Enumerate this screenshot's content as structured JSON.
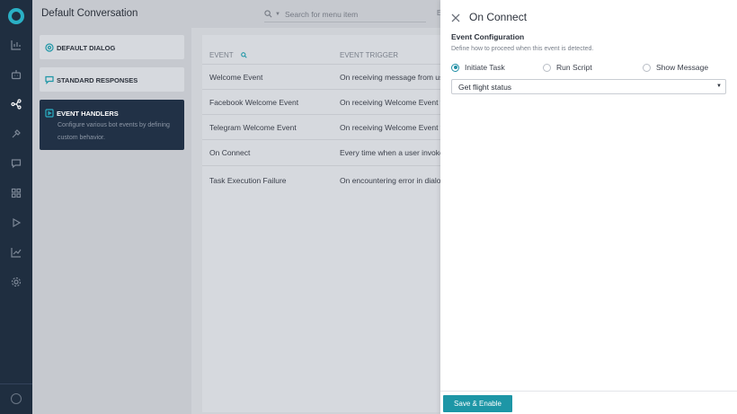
{
  "header": {
    "title": "Default Conversation",
    "search_placeholder": "Search for menu item",
    "cut_text": "E"
  },
  "sidebar_rail": {
    "items": [
      "dashboard-icon",
      "bot-icon",
      "flow-icon",
      "tools-icon",
      "chat-icon",
      "apps-icon",
      "play-icon",
      "analytics-icon",
      "settings-icon"
    ],
    "active_index": 2
  },
  "side_panel": {
    "cards": [
      {
        "label": "DEFAULT DIALOG"
      },
      {
        "label": "STANDARD RESPONSES"
      },
      {
        "label": "EVENT HANDLERS",
        "description": "Configure various bot events by defining custom behavior."
      }
    ]
  },
  "table": {
    "headers": {
      "event": "EVENT",
      "trigger": "EVENT TRIGGER"
    },
    "rows": [
      {
        "event": "Welcome Event",
        "trigger": "On receiving message from use"
      },
      {
        "event": "Facebook Welcome Event",
        "trigger": "On receiving Welcome Event f"
      },
      {
        "event": "Telegram Welcome Event",
        "trigger": "On receiving Welcome Event f"
      },
      {
        "event": "On Connect",
        "trigger": "Every time when a user invoke"
      },
      {
        "event": "Task Execution Failure",
        "trigger": "On encountering error in dialo"
      }
    ]
  },
  "panel": {
    "title": "On Connect",
    "section": "Event Configuration",
    "hint": "Define how to proceed when this event is detected.",
    "options": [
      {
        "label": "Initiate Task",
        "selected": true
      },
      {
        "label": "Run Script",
        "selected": false
      },
      {
        "label": "Show Message",
        "selected": false
      }
    ],
    "task_select_value": "Get flight status",
    "save_label": "Save & Enable"
  },
  "colors": {
    "accent": "#1d96a6",
    "rail_bg": "#1f2e40",
    "active_card": "#213146"
  }
}
